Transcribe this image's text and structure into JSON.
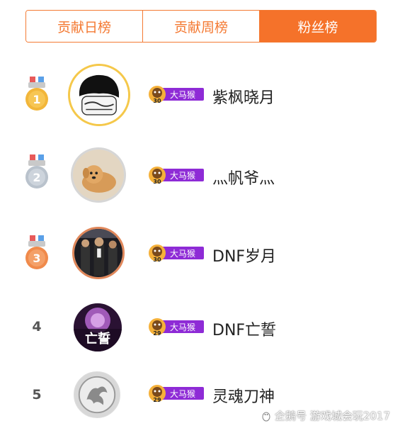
{
  "tabs": [
    {
      "label": "贡献日榜",
      "active": false
    },
    {
      "label": "贡献周榜",
      "active": false
    },
    {
      "label": "粉丝榜",
      "active": true
    }
  ],
  "rows": [
    {
      "rank": "1",
      "medal": "gold-medal",
      "badge_text": "大马猴",
      "badge_level": "30",
      "name": "紫枫晓月"
    },
    {
      "rank": "2",
      "medal": "silver-medal",
      "badge_text": "大马猴",
      "badge_level": "30",
      "name": "灬帆爷灬"
    },
    {
      "rank": "3",
      "medal": "bronze-medal",
      "badge_text": "大马猴",
      "badge_level": "30",
      "name": "DNF岁月"
    },
    {
      "rank": "4",
      "medal": null,
      "badge_text": "大马猴",
      "badge_level": "29",
      "name": "DNF亡誓"
    },
    {
      "rank": "5",
      "medal": null,
      "badge_text": "大马猴",
      "badge_level": "29",
      "name": "灵魂刀神"
    }
  ],
  "avatar4_text": "亡誓",
  "watermark": "企鹅号 游戏城会玩2017",
  "colors": {
    "accent": "#f5722a",
    "gold": "#f2b63a",
    "silver": "#b9c2cc",
    "bronze": "#f08a4b",
    "badge_purple": "#8e2bd6"
  }
}
